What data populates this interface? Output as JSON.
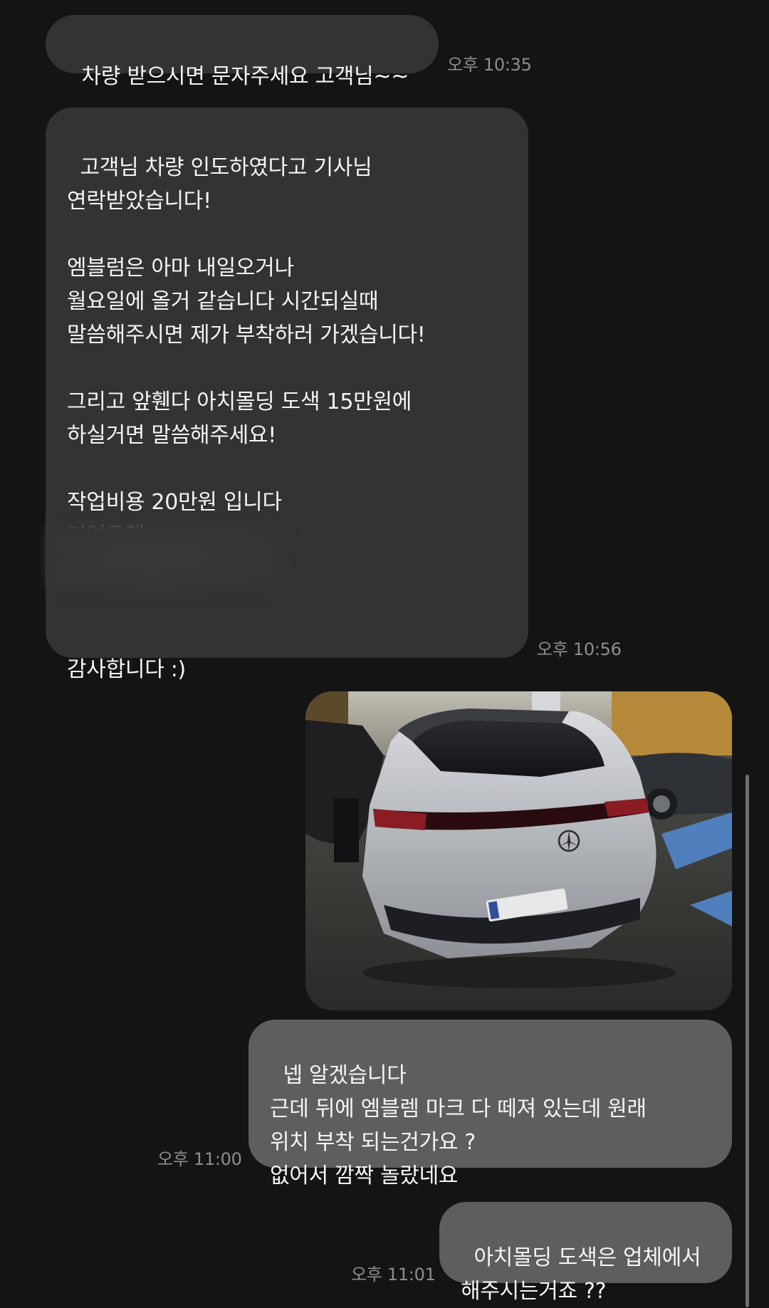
{
  "messages": [
    {
      "direction": "incoming",
      "lines": [
        "차량 받으시면 문자주세요 고객님~~"
      ],
      "time": "오후 10:35"
    },
    {
      "direction": "incoming",
      "lines": [
        "고객님 차량 인도하였다고 기사님",
        "연락받았습니다!",
        "",
        "엠블럼은 아마 내일오거나",
        "월요일에 올거 같습니다 시간되실때",
        "말씀해주시면 제가 부착하러 가겠습니다!",
        "",
        "그리고 앞휀다 아치몰딩 도색 15만원에",
        "하실거면 말씀해주세요!",
        "",
        "작업비용 20만원 입니다",
        "기업은행",
        "",
        "",
        "",
        "감사합니다 :)"
      ],
      "time": "오후 10:56"
    },
    {
      "direction": "outgoing",
      "type": "photo",
      "photo_icon": "car-photo-thumbnail"
    },
    {
      "direction": "outgoing",
      "lines": [
        "넵 알겠습니다",
        "근데 뒤에 엠블렘 마크 다 떼져 있는데 원래",
        "위치 부착 되는건가요 ?",
        "없어서 깜짝 놀랐네요"
      ],
      "time": "오후 11:00"
    },
    {
      "direction": "outgoing",
      "lines": [
        "아치몰딩 도색은 업체에서",
        "해주시는거죠 ??"
      ],
      "time": "오후 11:01"
    }
  ],
  "text": {
    "m1": "차량 받으시면 문자주세요 고객님~~",
    "m2": "고객님 차량 인도하였다고 기사님\n연락받았습니다!\n\n엠블럼은 아마 내일오거나\n월요일에 올거 같습니다 시간되실때\n말씀해주시면 제가 부착하러 가겠습니다!\n\n그리고 앞휀다 아치몰딩 도색 15만원에\n하실거면 말씀해주세요!\n\n작업비용 20만원 입니다\n기업은행\n\n\n\n감사합니다 :)",
    "m4": "넵 알겠습니다\n근데 뒤에 엠블렘 마크 다 떼져 있는데 원래\n위치 부착 되는건가요 ?\n없어서 깜짝 놀랐네요",
    "m5": "아치몰딩 도색은 업체에서\n해주시는거죠 ??"
  },
  "colors": {
    "background": "#141414",
    "incoming_bubble": "#333333",
    "outgoing_bubble": "#5e5e5e",
    "timestamp": "#8e8e8e",
    "text": "#f5f5f5"
  }
}
